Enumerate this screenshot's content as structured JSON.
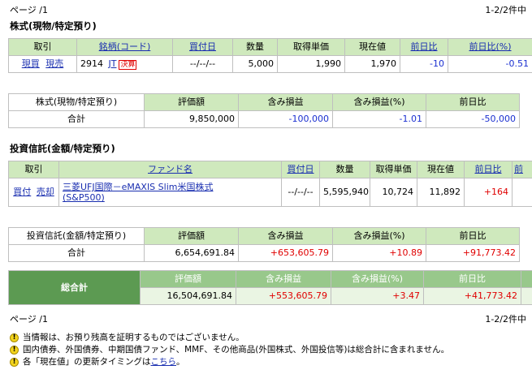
{
  "pager_top": {
    "left": "ページ /1",
    "right": "1-2/2件中"
  },
  "stocks": {
    "title": "株式(現物/特定預り)",
    "headers": [
      "取引",
      "銘柄(コード)",
      "買付日",
      "数量",
      "取得単価",
      "現在値",
      "前日比",
      "前日比(%)"
    ],
    "row": {
      "buy": "現買",
      "sell": "現売",
      "code": "2914",
      "name": "JT",
      "badge": "決算",
      "date": "--/--/--",
      "qty": "5,000",
      "cost": "1,990",
      "price": "1,970",
      "change": "-10",
      "change_pct": "-0.51"
    },
    "summary": {
      "label": "株式(現物/特定預り)",
      "total_label": "合計",
      "headers": [
        "評価額",
        "含み損益",
        "含み損益(%)",
        "前日比"
      ],
      "values": [
        "9,850,000",
        "-100,000",
        "-1.01",
        "-50,000"
      ]
    }
  },
  "funds": {
    "title": "投資信託(金額/特定預り)",
    "headers": [
      "取引",
      "ファンド名",
      "買付日",
      "数量",
      "取得単価",
      "現在値",
      "前日比",
      "前"
    ],
    "row": {
      "buy": "買付",
      "sell": "売却",
      "name_line1": "三菱UFJ国際－eMAXIS Slim米国株式",
      "name_line2": "(S&P500)",
      "date": "--/--/--",
      "qty": "5,595,940",
      "cost": "10,724",
      "price": "11,892",
      "change": "+164"
    },
    "summary": {
      "label": "投資信託(金額/特定預り)",
      "total_label": "合計",
      "headers": [
        "評価額",
        "含み損益",
        "含み損益(%)",
        "前日比"
      ],
      "values": [
        "6,654,691.84",
        "+653,605.79",
        "+10.89",
        "+91,773.42"
      ]
    }
  },
  "grand_total": {
    "label": "総合計",
    "headers": [
      "評価額",
      "含み損益",
      "含み損益(%)",
      "前日比"
    ],
    "values": [
      "16,504,691.84",
      "+553,605.79",
      "+3.47",
      "+41,773.42"
    ]
  },
  "pager_bottom": {
    "left": "ページ /1",
    "right": "1-2/2件中"
  },
  "notes": [
    {
      "text": "当情報は、お預り残高を証明するものではございません。"
    },
    {
      "text": "国内債券、外国債券、中期国債ファンド、MMF、その他商品(外国株式、外国投信等)は総合計に含まれません。"
    },
    {
      "text": "各「現在値」の更新タイミングは",
      "link": "こちら",
      "tail": "。"
    }
  ],
  "colors": {
    "header_green": "#cfe9bd",
    "total_green": "#5c9a52",
    "positive": "#e00000",
    "negative": "#1a2fd0",
    "link": "#1a2fb0"
  }
}
